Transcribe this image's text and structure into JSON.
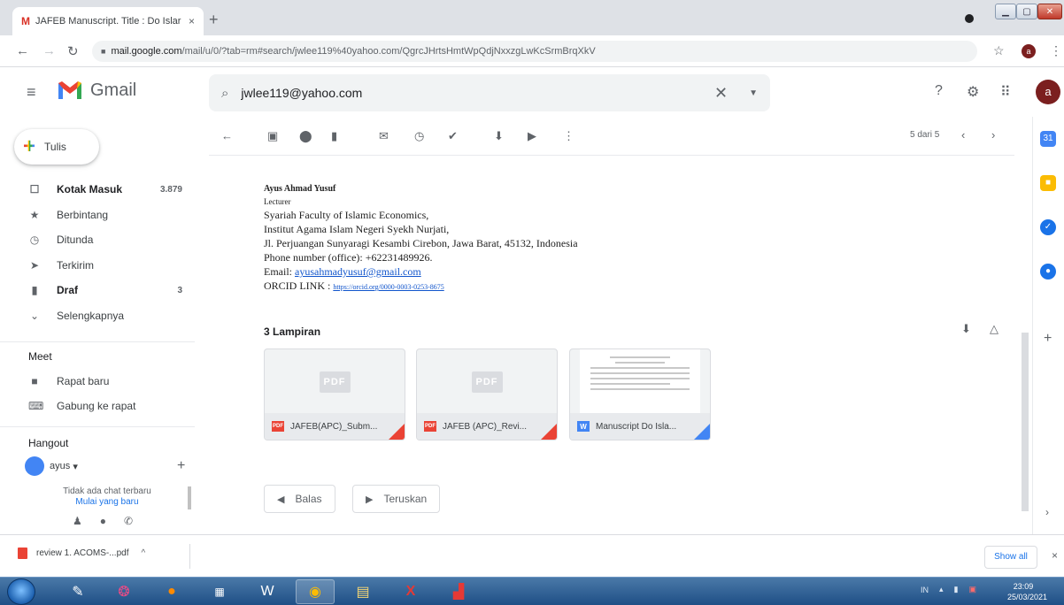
{
  "browser": {
    "tab_title": "JAFEB Manuscript. Title : Do Islar",
    "tab_close": "×",
    "new_tab": "+",
    "url_host": "mail.google.com",
    "url_path": "/mail/u/0/?tab=rm#search/jwlee119%40yahoo.com/QgrcJHrtsHmtWpQdjNxxzgLwKcSrmBrqXkV",
    "profile_initial": "a"
  },
  "gmail": {
    "brand": "Gmail",
    "search_value": "jwlee119@yahoo.com",
    "avatar_initial": "a"
  },
  "compose_label": "Tulis",
  "nav": [
    {
      "label": "Kotak Masuk",
      "count": "3.879",
      "icon": "inbox-icon",
      "glyph": "☐",
      "bold": true
    },
    {
      "label": "Berbintang",
      "count": "",
      "icon": "star-icon",
      "glyph": "★",
      "bold": false
    },
    {
      "label": "Ditunda",
      "count": "",
      "icon": "clock-icon",
      "glyph": "◷",
      "bold": false
    },
    {
      "label": "Terkirim",
      "count": "",
      "icon": "send-icon",
      "glyph": "➤",
      "bold": false
    },
    {
      "label": "Draf",
      "count": "3",
      "icon": "draft-icon",
      "glyph": "▮",
      "bold": true
    },
    {
      "label": "Selengkapnya",
      "count": "",
      "icon": "chevron-down-icon",
      "glyph": "⌄",
      "bold": false
    }
  ],
  "meet": {
    "title": "Meet",
    "new_meeting": "Rapat baru",
    "join_meeting": "Gabung ke rapat"
  },
  "hangout": {
    "title": "Hangout",
    "user": "ayus",
    "user_caret": "▾",
    "no_chat": "Tidak ada chat terbaru",
    "start_new": "Mulai yang baru"
  },
  "message": {
    "pager": "5 dari 5",
    "signature": {
      "name": "Ayus Ahmad Yusuf",
      "role": "Lecturer",
      "faculty": "Syariah Faculty of Islamic Economics,",
      "institute": "Institut Agama Islam Negeri Syekh Nurjati,",
      "address": "Jl. Perjuangan Sunyaragi Kesambi Cirebon, Jawa Barat, 45132, Indonesia",
      "phone": "Phone number (office): +62231489926.",
      "email_label": "Email: ",
      "email": "ayusahmadyusuf@gmail.com",
      "orcid_label": "ORCID LINK : ",
      "orcid": "https://orcid.org/0000-0003-0253-8675"
    },
    "attachments_title": "3 Lampiran",
    "attachments": [
      {
        "name": "JAFEB(APC)_Subm...",
        "type": "PDF",
        "preview": "PDF",
        "type_color": "#ea4335"
      },
      {
        "name": "JAFEB (APC)_Revi...",
        "type": "PDF",
        "preview": "PDF",
        "type_color": "#ea4335"
      },
      {
        "name": "Manuscript Do Isla...",
        "type": "W",
        "preview": "",
        "type_color": "#4285f4"
      }
    ],
    "reply_label": "Balas",
    "forward_label": "Teruskan"
  },
  "downloads": {
    "file": "review 1. ACOMS-...pdf",
    "caret": "^",
    "show_all": "Show all",
    "close": "×"
  },
  "taskbar": {
    "lang": "IN",
    "time": "23:09",
    "date": "25/03/2021"
  },
  "colors": {
    "gmail_red": "#ea4335",
    "gmail_blue": "#4285f4",
    "link_blue": "#1155cc"
  }
}
